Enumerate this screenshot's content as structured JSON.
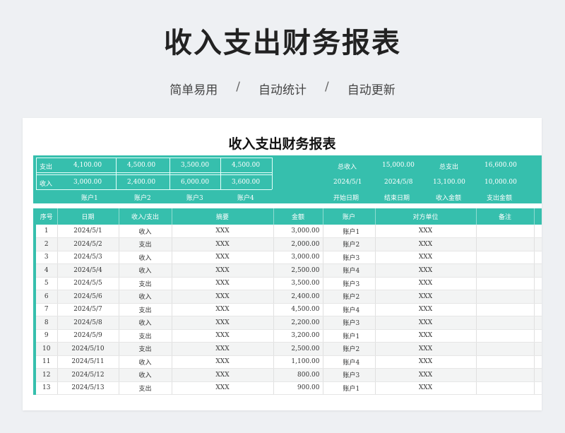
{
  "hero": {
    "title": "收入支出财务报表",
    "tags": [
      "简单易用",
      "自动统计",
      "自动更新"
    ],
    "separator": "/"
  },
  "sheet": {
    "title": "收入支出财务报表",
    "summary": {
      "row_expense_label": "支出",
      "row_income_label": "收入",
      "accounts": [
        "账户1",
        "账户2",
        "账户3",
        "账户4"
      ],
      "expense_values": [
        "4,100.00",
        "4,500.00",
        "3,500.00",
        "4,500.00"
      ],
      "income_values": [
        "3,000.00",
        "2,400.00",
        "6,000.00",
        "3,600.00"
      ],
      "total_income_label": "总收入",
      "total_income_value": "15,000.00",
      "total_expense_label": "总支出",
      "total_expense_value": "16,600.00",
      "start_date": "2024/5/1",
      "end_date": "2024/5/8",
      "income_amount": "13,100.00",
      "expense_amount": "10,000.00",
      "start_date_label": "开始日期",
      "end_date_label": "结束日期",
      "income_amount_label": "收入金额",
      "expense_amount_label": "支出金额"
    },
    "columns": [
      "序号",
      "日期",
      "收入/支出",
      "摘要",
      "金额",
      "账户",
      "对方单位",
      "备注"
    ],
    "rows": [
      [
        "1",
        "2024/5/1",
        "收入",
        "XXX",
        "3,000.00",
        "账户1",
        "XXX",
        ""
      ],
      [
        "2",
        "2024/5/2",
        "支出",
        "XXX",
        "2,000.00",
        "账户2",
        "XXX",
        ""
      ],
      [
        "3",
        "2024/5/3",
        "收入",
        "XXX",
        "3,000.00",
        "账户3",
        "XXX",
        ""
      ],
      [
        "4",
        "2024/5/4",
        "收入",
        "XXX",
        "2,500.00",
        "账户4",
        "XXX",
        ""
      ],
      [
        "5",
        "2024/5/5",
        "支出",
        "XXX",
        "3,500.00",
        "账户3",
        "XXX",
        ""
      ],
      [
        "6",
        "2024/5/6",
        "收入",
        "XXX",
        "2,400.00",
        "账户2",
        "XXX",
        ""
      ],
      [
        "7",
        "2024/5/7",
        "支出",
        "XXX",
        "4,500.00",
        "账户4",
        "XXX",
        ""
      ],
      [
        "8",
        "2024/5/8",
        "收入",
        "XXX",
        "2,200.00",
        "账户3",
        "XXX",
        ""
      ],
      [
        "9",
        "2024/5/9",
        "支出",
        "XXX",
        "3,200.00",
        "账户1",
        "XXX",
        ""
      ],
      [
        "10",
        "2024/5/10",
        "支出",
        "XXX",
        "2,500.00",
        "账户2",
        "XXX",
        ""
      ],
      [
        "11",
        "2024/5/11",
        "收入",
        "XXX",
        "1,100.00",
        "账户4",
        "XXX",
        ""
      ],
      [
        "12",
        "2024/5/12",
        "收入",
        "XXX",
        "800.00",
        "账户3",
        "XXX",
        ""
      ],
      [
        "13",
        "2024/5/13",
        "支出",
        "XXX",
        "900.00",
        "账户1",
        "XXX",
        ""
      ]
    ]
  },
  "colors": {
    "accent": "#36bfad",
    "background": "#eef0f3"
  }
}
